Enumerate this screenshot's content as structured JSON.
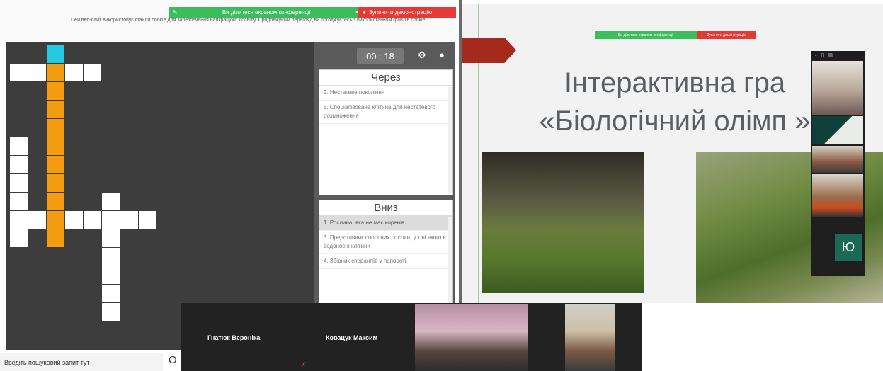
{
  "share_banner": {
    "sharing_label": "Ви ділитеся екраном конференції",
    "stop_label": "Зупинити демонстрацію",
    "notice": "Цей веб-сайт використовує файли cookie для забезпечення найкращого досвіду. Продовжуючи перегляд ви погоджуєтесь з використанням файлів cookie"
  },
  "crossword": {
    "timer": "00 : 18",
    "across_title": "Через",
    "across_clues": [
      "2. Нестатеве покоління",
      "5. Спеціалізована клітина для нестатевого розмноження"
    ],
    "down_title": "Вниз",
    "down_clues": [
      "1. Рослина, яка не має коренів",
      "3. Представник спорових рослин, у тілі якого є водоносні клітини",
      "4. Збірник спорангіїв у папороті"
    ]
  },
  "search": {
    "placeholder": "Введіть пошуковий запит тут"
  },
  "slide": {
    "share_label": "Ви ділитеся екраном конференції",
    "stop_label": "Зупинити демонстрацію",
    "title_line1": "Інтерактивна гра",
    "title_line2": "«Біологічний олімп »"
  },
  "side_participants": {
    "avatar_letter": "Ю"
  },
  "bottom_participants": {
    "p1": "Гнатюк Вероніка",
    "p2": "Ковацук Максим"
  }
}
